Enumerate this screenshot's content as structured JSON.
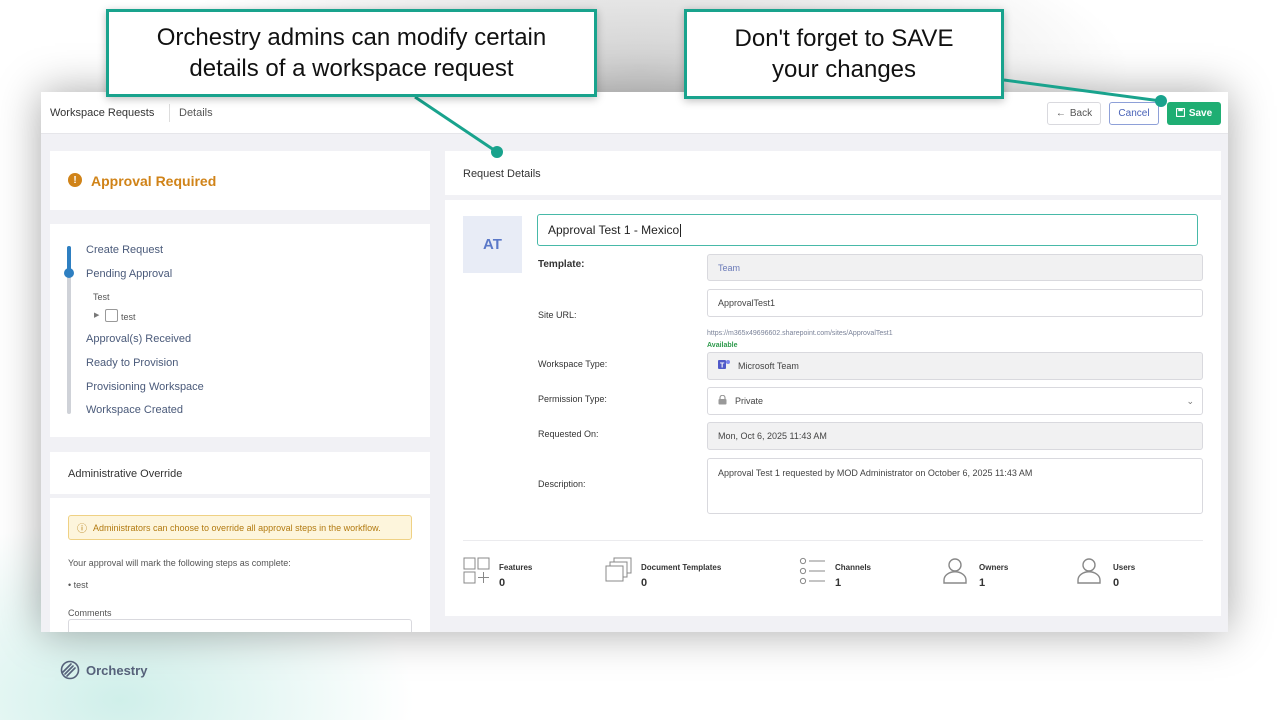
{
  "breadcrumb": {
    "section": "Workspace Requests",
    "current": "Details"
  },
  "toolbar": {
    "back_label": "Back",
    "cancel_label": "Cancel",
    "save_label": "Save"
  },
  "status": {
    "title": "Approval Required",
    "color": "#d08318"
  },
  "workflow": {
    "steps": [
      "Create Request",
      "Pending Approval",
      "Approval(s) Received",
      "Ready to Provision",
      "Provisioning Workspace",
      "Workspace Created"
    ],
    "substep_group": "Test",
    "substep_item": "test"
  },
  "override": {
    "title": "Administrative Override",
    "alert": "Administrators can choose to override all approval steps in the workflow.",
    "steps_text": "Your approval will mark the following steps as complete:",
    "steps": [
      "test"
    ],
    "comments_label": "Comments"
  },
  "request": {
    "header": "Request Details",
    "avatar_initials": "AT",
    "name": "Approval Test 1 - Mexico",
    "template_label": "Template:",
    "template_value": "Team",
    "site_url_label": "Site URL:",
    "site_url_value": "ApprovalTest1",
    "site_url_full": "https://m365x49696602.sharepoint.com/sites/ApprovalTest1",
    "site_url_status": "Available",
    "workspace_type_label": "Workspace Type:",
    "workspace_type_value": "Microsoft Team",
    "permission_type_label": "Permission Type:",
    "permission_type_value": "Private",
    "requested_on_label": "Requested On:",
    "requested_on_value": "Mon, Oct 6, 2025 11:43 AM",
    "description_label": "Description:",
    "description_value": "Approval Test 1 requested by MOD Administrator on October 6, 2025 11:43 AM"
  },
  "stats": [
    {
      "label": "Features",
      "value": "0"
    },
    {
      "label": "Document Templates",
      "value": "0"
    },
    {
      "label": "Channels",
      "value": "1"
    },
    {
      "label": "Owners",
      "value": "1"
    },
    {
      "label": "Users",
      "value": "0"
    }
  ],
  "callouts": {
    "left_line1": "Orchestry admins can modify certain",
    "left_line2": "details of a workspace request",
    "right_line1": "Don't forget to SAVE",
    "right_line2": "your changes"
  },
  "brand": {
    "name": "Orchestry"
  },
  "colors": {
    "accent": "#19a38d",
    "save": "#1fae73",
    "progress": "#2e7fc1"
  }
}
